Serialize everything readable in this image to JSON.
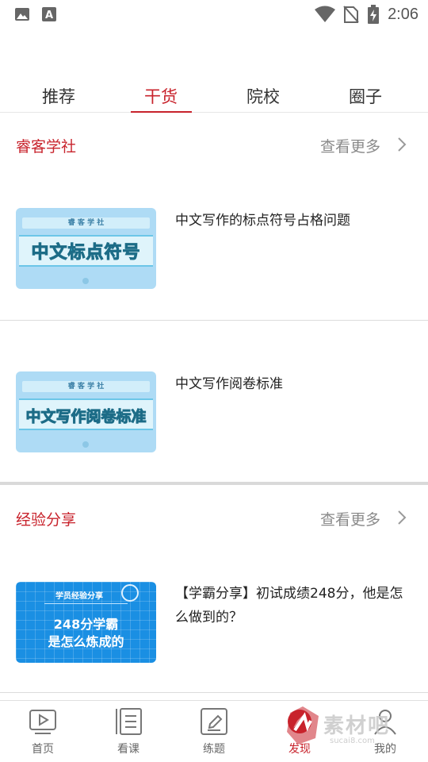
{
  "status_bar": {
    "time": "2:06",
    "icons": [
      "image-icon",
      "font-icon",
      "wifi-icon",
      "no-sim-icon",
      "battery-charging-icon"
    ]
  },
  "tabs": [
    {
      "label": "推荐",
      "active": false
    },
    {
      "label": "干货",
      "active": true
    },
    {
      "label": "院校",
      "active": false
    },
    {
      "label": "圈子",
      "active": false
    }
  ],
  "sections": [
    {
      "title": "睿客学社",
      "more_label": "查看更多",
      "articles": [
        {
          "title": "中文写作的标点符号占格问题",
          "thumb_top": "睿 客 学 社",
          "thumb_text": "中文标点符号"
        },
        {
          "title": "中文写作阅卷标准",
          "thumb_top": "睿 客 学 社",
          "thumb_text": "中文写作阅卷标准"
        }
      ]
    },
    {
      "title": "经验分享",
      "more_label": "查看更多",
      "articles": [
        {
          "title": "【学霸分享】初试成绩248分，他是怎么做到的？",
          "thumb_tag": "学员经验分享",
          "thumb_line1": "248分学霸",
          "thumb_line2": "是怎么炼成的"
        }
      ]
    }
  ],
  "bottom_nav": [
    {
      "label": "首页",
      "icon": "video-play-icon",
      "active": false
    },
    {
      "label": "看课",
      "icon": "book-list-icon",
      "active": false
    },
    {
      "label": "练题",
      "icon": "pen-edit-icon",
      "active": false
    },
    {
      "label": "发现",
      "icon": "compass-icon",
      "active": true
    },
    {
      "label": "我的",
      "icon": "user-icon",
      "active": false
    }
  ],
  "watermark": {
    "text": "素材吧",
    "sub": "sucai8.com"
  },
  "colors": {
    "accent": "#c8232c",
    "muted": "#8a8a8a",
    "divider": "#dcdcdc"
  }
}
